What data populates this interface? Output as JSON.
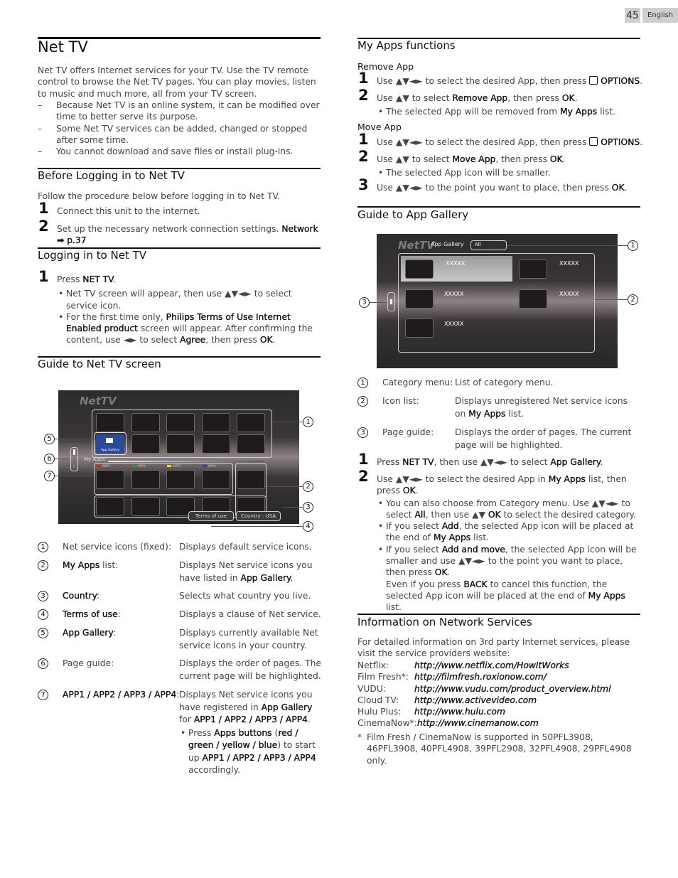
{
  "page": {
    "number": "45",
    "language": "English"
  },
  "left": {
    "title": "Net TV",
    "intro": "Net TV offers Internet services for your TV. Use the TV remote control to browse the Net TV pages. You can play movies, listen to music and much more, all from your TV screen.",
    "notes": [
      "Because Net TV is an online system, it can be modified over time to better serve its purpose.",
      "Some Net TV services can be added, changed or stopped after some time.",
      "You cannot download and save files or install plug-ins."
    ],
    "before_login": {
      "heading": "Before Logging in to Net TV",
      "intro": "Follow the procedure below before logging in to Net TV.",
      "steps": [
        {
          "num": "1",
          "text": "Connect this unit to the internet."
        },
        {
          "num": "2",
          "text": "Set up the necessary network connection settings.",
          "bold": "Network",
          "ref": "➡ p.37"
        }
      ]
    },
    "login": {
      "heading": "Logging in to Net TV",
      "step_num": "1",
      "step_pre": "Press ",
      "step_bold": "NET TV",
      "step_post": ".",
      "bullet1": "Net TV screen will appear, then use ▲▼◄► to select service icon.",
      "bullet2_pre": "For the first time only, ",
      "bullet2_bold": "Philips Terms of Use Internet Enabled product",
      "bullet2_mid": " screen will appear. After confirming the content, use ◄► to select ",
      "bullet2_agree": "Agree",
      "bullet2_then": ", then press ",
      "bullet2_ok": "OK",
      "bullet2_end": "."
    },
    "guide_screen": {
      "heading": "Guide to Net TV screen",
      "screen": {
        "logo": "NetTV",
        "app_gallery_label": "App Gallery",
        "my_apps_label": "My Apps",
        "apps": [
          {
            "label": "APP1",
            "color": "#e0141e"
          },
          {
            "label": "APP2",
            "color": "#1aa53a"
          },
          {
            "label": "APP3",
            "color": "#f2e20f"
          },
          {
            "label": "APP4",
            "color": "#3046b0"
          }
        ],
        "terms_button": "Terms of use",
        "country_button": "Country : USA"
      },
      "callouts": [
        "1",
        "2",
        "3",
        "4",
        "5",
        "6",
        "7"
      ],
      "legend": [
        {
          "n": "1",
          "key": "Net service icons (fixed):",
          "key_bold": false,
          "desc": "Displays default service icons."
        },
        {
          "n": "2",
          "key_bold_part": "My Apps",
          "key_rest": " list:",
          "desc_pre": "Displays Net service icons you have listed in ",
          "desc_bold": "App Gallery",
          "desc_post": "."
        },
        {
          "n": "3",
          "key_bold_part": "Country",
          "key_rest": ":",
          "desc": "Selects what country you live."
        },
        {
          "n": "4",
          "key_bold_part": "Terms of use",
          "key_rest": ":",
          "desc": "Displays a clause of Net service."
        },
        {
          "n": "5",
          "key_bold_part": "App Gallery",
          "key_rest": ":",
          "desc": "Displays currently available Net service icons in your country."
        },
        {
          "n": "6",
          "key": "Page guide:",
          "desc": "Displays the order of pages. The current page will be highlighted."
        },
        {
          "n": "7",
          "key_bold_part": "APP1 / APP2 / APP3 / APP4",
          "key_rest": ":",
          "desc_pre": "Displays Net service icons you have registered in ",
          "desc_bold": "App Gallery",
          "desc_mid": " for ",
          "desc_bold2": "APP1 / APP2 / APP3 / APP4",
          "desc_post": ".",
          "bullet_pre": "Press ",
          "bullet_bold": "Apps buttons",
          "bullet_paren_open": " (",
          "bullet_colors": "red / green / yellow / blue",
          "bullet_paren_close": ") to start up ",
          "bullet_apps": "APP1 / APP2 / APP3 / APP4",
          "bullet_post": " accordingly."
        }
      ]
    }
  },
  "right": {
    "my_apps_functions": {
      "heading": "My Apps functions",
      "remove": {
        "subheading": "Remove App",
        "step1": {
          "num": "1",
          "pre": "Use ▲▼◄► to select the desired App, then press ",
          "icon": "options-icon",
          "bold": "OPTIONS",
          "post": "."
        },
        "step2": {
          "num": "2",
          "pre": "Use ▲▼ to select ",
          "bold": "Remove App",
          "mid": ", then press ",
          "ok": "OK",
          "post": "."
        },
        "bullet": {
          "pre": "The selected App will be removed from ",
          "bold": "My Apps",
          "post": " list."
        }
      },
      "move": {
        "subheading": "Move App",
        "step1": {
          "num": "1",
          "pre": "Use ▲▼◄► to select the desired App, then press ",
          "icon": "options-icon",
          "bold": "OPTIONS",
          "post": "."
        },
        "step2": {
          "num": "2",
          "pre": "Use ▲▼ to select ",
          "bold": "Move App",
          "mid": ", then press ",
          "ok": "OK",
          "post": "."
        },
        "bullet": "The selected App icon will be smaller.",
        "step3": {
          "num": "3",
          "pre": "Use ▲▼◄► to the point you want to place, then press ",
          "ok": "OK",
          "post": "."
        }
      }
    },
    "app_gallery": {
      "heading": "Guide to App Gallery",
      "screen": {
        "logo": "NetTV",
        "title": "App Gallery",
        "category_value": "All",
        "items": [
          "XXXXX",
          "XXXXX",
          "XXXXX",
          "XXXXX",
          "XXXXX"
        ]
      },
      "callouts": [
        "1",
        "2",
        "3"
      ],
      "legend": [
        {
          "n": "1",
          "key": "Category menu:",
          "desc": "List of category menu."
        },
        {
          "n": "2",
          "key": "Icon list:",
          "desc_pre": "Displays unregistered Net service icons on ",
          "desc_bold": "My Apps",
          "desc_post": " list."
        },
        {
          "n": "3",
          "key": "Page guide:",
          "desc": "Displays the order of pages. The current page will be highlighted."
        }
      ],
      "step1": {
        "num": "1",
        "pre": "Press ",
        "bold": "NET TV",
        "mid": ", then use ▲▼◄► to select ",
        "bold2": "App Gallery",
        "post": "."
      },
      "step2": {
        "num": "2",
        "pre": "Use ▲▼◄► to select the desired App in ",
        "bold": "My Apps",
        "mid": " list, then press ",
        "ok": "OK",
        "post": "."
      },
      "bullets": {
        "b1_pre": "You can also choose from Category menu. Use ▲▼◄► to select ",
        "b1_all": "All",
        "b1_mid": ", then use ▲▼ ",
        "b1_ok": "OK",
        "b1_post": " to select the desired category.",
        "b2_pre": "If you select ",
        "b2_add": "Add",
        "b2_mid": ", the selected App icon will be placed at the end of ",
        "b2_myapps": "My Apps",
        "b2_post": " list.",
        "b3_pre": "If you select ",
        "b3_add": "Add and move",
        "b3_mid": ", the selected App icon will be smaller and use ▲▼◄► to the point you want to place, then press ",
        "b3_ok": "OK",
        "b3_post": ".",
        "b3_extra_pre": "Even if you press ",
        "b3_back": "BACK",
        "b3_extra_mid": " to cancel this function, the selected App icon will be placed at the end of ",
        "b3_myapps": "My Apps",
        "b3_extra_post": " list."
      }
    },
    "network_services": {
      "heading": "Information on Network Services",
      "intro": "For detailed information on 3rd party Internet services, please visit the service providers website:",
      "services": [
        {
          "name": "Netflix:",
          "url": "http://www.netflix.com/HowItWorks"
        },
        {
          "name": "Film Fresh*:",
          "url": "http://filmfresh.roxionow.com/"
        },
        {
          "name": "VUDU:",
          "url": "http://www.vudu.com/product_overview.html"
        },
        {
          "name": "Cloud TV:",
          "url": "http://www.activevideo.com"
        },
        {
          "name": "Hulu Plus:",
          "url": "http://www.hulu.com"
        },
        {
          "name": "CinemaNow*:",
          "url": "http://www.cinemanow.com"
        }
      ],
      "footnote": "Film Fresh / CinemaNow is supported in 50PFL3908, 46PFL3908, 40PFL4908, 39PFL2908, 32PFL4908, 29PFL4908 only.",
      "footnote_mark": "*"
    }
  }
}
